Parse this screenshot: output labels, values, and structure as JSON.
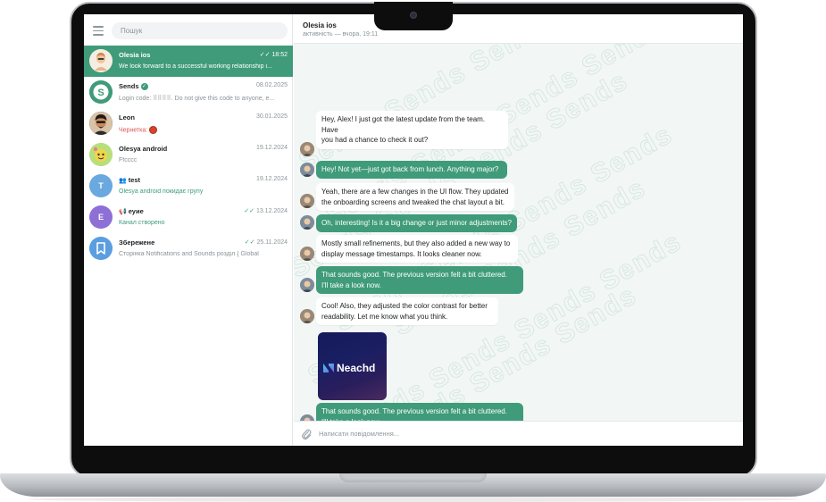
{
  "sidebar": {
    "search_placeholder": "Пошук",
    "chats": [
      {
        "name": "Olesia ios",
        "time": "18:52",
        "preview": "We look forward to a successful working relationship i...",
        "read": true,
        "active": true,
        "avatar_color": "#e8c7a0"
      },
      {
        "name": "Sends",
        "time": "08.02.2025",
        "preview": "Login code: ⠿⠿⠿⠿. Do not give this code to anyone, e...",
        "verified": true,
        "avatar_color": "#3f9b79",
        "avatar_letter": "S"
      },
      {
        "name": "Leon",
        "time": "30.01.2025",
        "draft_label": "Чернетка:",
        "avatar_color": "#3b2e2a"
      },
      {
        "name": "Olesya android",
        "time": "19.12.2024",
        "preview": "Ffcccc",
        "avatar_color": "#9fd46a"
      },
      {
        "name": "test",
        "time": "19.12.2024",
        "preview": "Olesya android покидає групу",
        "group": true,
        "avatar_color": "#6aa8e0",
        "avatar_letter": "T"
      },
      {
        "name": "еуие",
        "time": "13.12.2024",
        "preview": "Канал створено",
        "channel": true,
        "read": true,
        "avatar_color": "#8d6fd6",
        "avatar_letter": "E"
      },
      {
        "name": "Збережене",
        "time": "25.11.2024",
        "preview": "Сторінка Notifications and Sounds розділ { Global",
        "read": true,
        "avatar_color": "#5b9ee0"
      }
    ]
  },
  "chat": {
    "title": "Olesia ios",
    "status": "активність — вчора, 19:11",
    "messages": [
      {
        "dir": "in",
        "text_lines": [
          "Hey, Alex! I just got the latest update from the team. Have",
          "you had a chance to check it out?"
        ]
      },
      {
        "dir": "out",
        "text_lines": [
          "Hey! Not yet—just got back from lunch. Anything major?"
        ]
      },
      {
        "dir": "in",
        "text_lines": [
          "Yeah, there are a few changes in the UI flow. They updated",
          "the onboarding screens and tweaked the chat layout a bit."
        ]
      },
      {
        "dir": "out",
        "text_lines": [
          "Oh, interesting! Is it a big change or just minor adjustments?"
        ]
      },
      {
        "dir": "in",
        "text_lines": [
          "Mostly small refinements, but they also added a new way to",
          "display message timestamps. It looks cleaner now."
        ]
      },
      {
        "dir": "out",
        "text_lines": [
          "That sounds good. The previous version felt a bit cluttered.",
          "I'll take a look now."
        ]
      },
      {
        "dir": "in",
        "text_lines": [
          "Cool! Also, they adjusted the color contrast for better",
          "readability. Let me know what you think."
        ]
      },
      {
        "dir": "out",
        "text_lines": [
          "That sounds good. The previous version felt a bit cluttered.",
          "I'll take a look now."
        ]
      }
    ],
    "image_logo_text": "Neachd",
    "composer_placeholder": "Написати повідомлення..."
  },
  "colors": {
    "accent": "#3f9b79",
    "draft": "#d9534f"
  }
}
